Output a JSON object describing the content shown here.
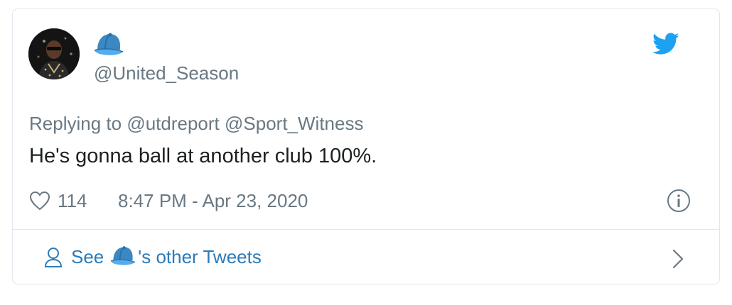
{
  "tweet": {
    "display_name_icon": "blue-cap-icon",
    "handle": "@United_Season",
    "replying_prefix": "Replying to",
    "reply_mentions": [
      "@utdreport",
      "@Sport_Witness"
    ],
    "text": "He's gonna ball at another club 100%.",
    "like_count": "114",
    "timestamp": "8:47 PM - Apr 23, 2020"
  },
  "footer": {
    "see_label": "See",
    "other_tweets_label": "'s other Tweets"
  },
  "icons": {
    "logo": "twitter-bird-icon",
    "like": "heart-icon",
    "info": "info-icon",
    "profile": "person-icon",
    "chevron": "chevron-right-icon"
  },
  "colors": {
    "accent": "#2b7bb9",
    "twitter_blue": "#1da1f2",
    "muted_text": "#697882",
    "border": "#e1e8ed",
    "cap_blue": "#3b88c3"
  }
}
